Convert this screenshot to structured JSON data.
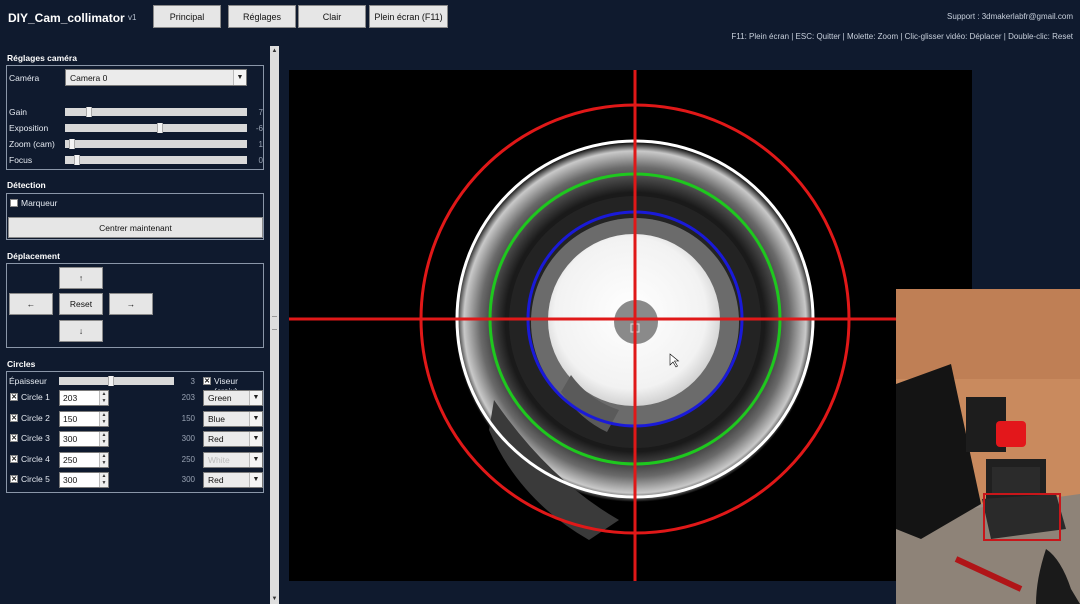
{
  "app": {
    "title": "DIY_Cam_collimator",
    "version": "v1"
  },
  "top_buttons": [
    "Principal",
    "Réglages",
    "Clair",
    "Plein écran (F11)"
  ],
  "support": "Support : 3dmakerlabfr@gmail.com",
  "shortcuts": "F11: Plein écran  |  ESC: Quitter  |  Molette: Zoom  |  Clic-glisser vidéo: Déplacer  |  Double-clic: Reset",
  "camera_settings": {
    "title": "Réglages caméra",
    "camera_label": "Caméra",
    "camera_value": "Camera 0",
    "sliders": [
      {
        "label": "Gain",
        "value": "7",
        "position": 0.12
      },
      {
        "label": "Exposition",
        "value": "-6",
        "position": 0.52
      },
      {
        "label": "Zoom (cam)",
        "value": "1",
        "position": 0.02
      },
      {
        "label": "Focus",
        "value": "0",
        "position": 0.05
      }
    ]
  },
  "detection": {
    "title": "Détection",
    "marker_label": "Marqueur",
    "marker_checked": false,
    "center_button": "Centrer maintenant"
  },
  "movement": {
    "title": "Déplacement",
    "up": "↑",
    "down": "↓",
    "left": "←",
    "right": "→",
    "reset": "Reset"
  },
  "circles": {
    "title": "Circles",
    "thickness_label": "Épaisseur",
    "thickness_value": "3",
    "thickness_position": 0.45,
    "crosshair_label": "Viseur (croix)",
    "crosshair_checked": true,
    "items": [
      {
        "label": "Circle 1",
        "spin": "203",
        "value": "203",
        "color": "Green",
        "checked": true
      },
      {
        "label": "Circle 2",
        "spin": "150",
        "value": "150",
        "color": "Blue",
        "checked": true
      },
      {
        "label": "Circle 3",
        "spin": "300",
        "value": "300",
        "color": "Red",
        "checked": true
      },
      {
        "label": "Circle 4",
        "spin": "250",
        "value": "250",
        "color": "White",
        "checked": true
      },
      {
        "label": "Circle 5",
        "spin": "300",
        "value": "300",
        "color": "Red",
        "checked": true
      }
    ]
  },
  "overlay_colors": {
    "red": "#e01818",
    "white": "#ffffff",
    "green": "#1ec81e",
    "blue": "#1a1ad8"
  }
}
